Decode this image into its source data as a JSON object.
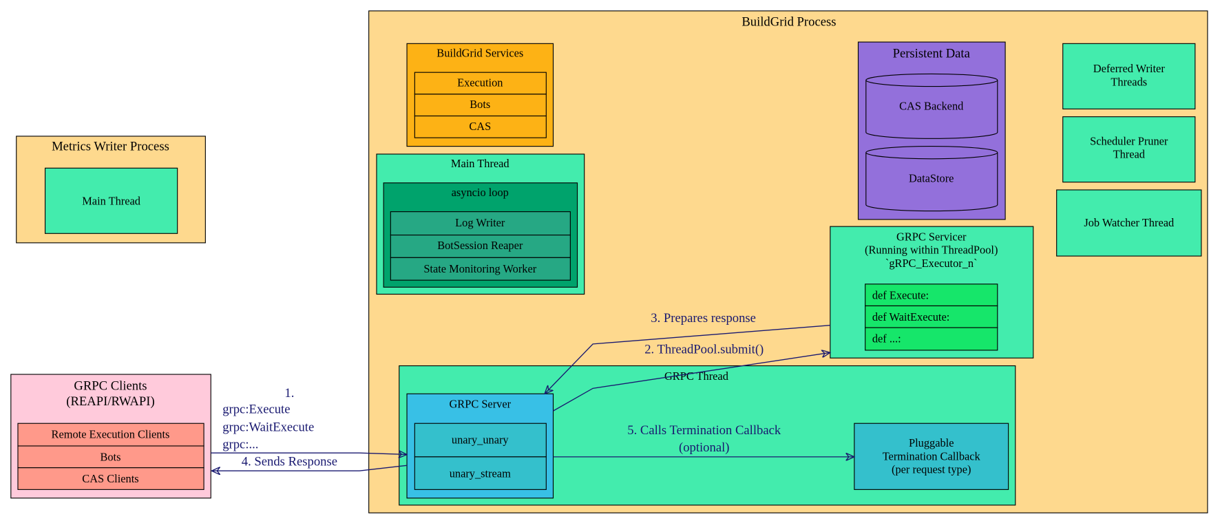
{
  "colors": {
    "process_bg": "#fed98e",
    "thread_green": "#43ecad",
    "services_orange": "#fdb215",
    "asyncio_green": "#00a36c",
    "asyncio_rows": "#26a884",
    "persistent_purple": "#9370db",
    "clients_pink": "#ffcadb",
    "clients_rows": "#ff998a",
    "server_blue": "#38c0e6",
    "server_rows": "#34c0cc",
    "servicer_rows": "#16e66a",
    "edge": "#191970"
  },
  "metrics": {
    "title": "Metrics Writer Process",
    "main_thread": "Main Thread"
  },
  "clients": {
    "title_1": "GRPC Clients",
    "title_2": "(REAPI/RWAPI)",
    "rows": [
      "Remote Execution Clients",
      "Bots",
      "CAS Clients"
    ]
  },
  "buildgrid": {
    "title": "BuildGrid Process",
    "services": {
      "title": "BuildGrid Services",
      "rows": [
        "Execution",
        "Bots",
        "CAS"
      ]
    },
    "main_thread": {
      "title": "Main Thread",
      "asyncio": {
        "title": "asyncio loop",
        "rows": [
          "Log Writer",
          "BotSession Reaper",
          "State Monitoring Worker"
        ]
      }
    },
    "persistent": {
      "title": "Persistent Data",
      "stores": [
        "CAS Backend",
        "DataStore"
      ]
    },
    "threads": {
      "deferred_1": "Deferred Writer",
      "deferred_2": "Threads",
      "pruner_1": "Scheduler Pruner",
      "pruner_2": "Thread",
      "watcher": "Job Watcher Thread"
    },
    "servicer": {
      "title_1": "GRPC Servicer",
      "title_2": "(Running within ThreadPool)",
      "title_3": "`gRPC_Executor_n`",
      "rows": [
        "def Execute:",
        "def WaitExecute:",
        "def ...:"
      ]
    },
    "grpc_thread": {
      "title": "GRPC Thread"
    },
    "server": {
      "title": "GRPC Server",
      "rows": [
        "unary_unary",
        "unary_stream"
      ]
    },
    "callback": {
      "line_1": "Pluggable",
      "line_2": "Termination Callback",
      "line_3": "(per request type)"
    }
  },
  "edges": {
    "e1": [
      "1.",
      "grpc:Execute",
      "grpc:WaitExecute",
      "grpc:..."
    ],
    "e2": "2. ThreadPool.submit()",
    "e3": "3. Prepares response",
    "e4": "4. Sends Response",
    "e5": [
      "5. Calls Termination Callback",
      "(optional)"
    ]
  }
}
